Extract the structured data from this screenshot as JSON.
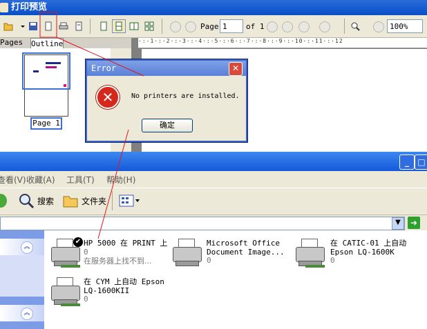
{
  "print_preview": {
    "title": "打印预览",
    "toolbar": {
      "page_label": "Page",
      "page_value": "1",
      "of_label": "of 1",
      "zoom_value": "100%"
    },
    "tabs": {
      "pages": "Pages",
      "outline": "Outline"
    },
    "thumb_label": "Page 1"
  },
  "error_dialog": {
    "title": "Error",
    "message": "No printers are installed.",
    "ok_label": "确定"
  },
  "explorer": {
    "menu": [
      "查看(V)",
      "收藏(A)",
      "工具(T)",
      "帮助(H)"
    ],
    "toolbar": {
      "search_label": "搜索",
      "folders_label": "文件夹"
    },
    "printers": [
      {
        "name_line1": "HP 5000 在 PRINT 上",
        "name_line2": "",
        "count": "0",
        "status": "在服务器上找不到..."
      },
      {
        "name_line1": "Microsoft Office",
        "name_line2": "Document Image...",
        "count": "0",
        "status": ""
      },
      {
        "name_line1": "在 CATIC-01 上自动",
        "name_line2": "Epson LQ-1600K",
        "count": "0",
        "status": ""
      },
      {
        "name_line1": "在 CYM 上自动 Epson",
        "name_line2": "LQ-1600KII",
        "count": "0",
        "status": ""
      }
    ]
  },
  "colors": {
    "annotation": "#e0141c",
    "titlebar": "#0a4fc9",
    "dialog_border": "#3c63c8"
  }
}
